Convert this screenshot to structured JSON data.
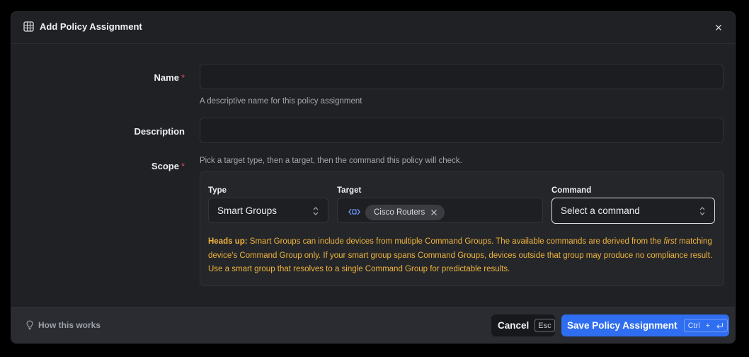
{
  "dialog": {
    "title": "Add Policy Assignment"
  },
  "form": {
    "name": {
      "label": "Name",
      "required_mark": "*",
      "value": "",
      "placeholder": "",
      "hint": "A descriptive name for this policy assignment"
    },
    "description": {
      "label": "Description",
      "value": "",
      "placeholder": ""
    },
    "scope": {
      "label": "Scope",
      "required_mark": "*",
      "hint": "Pick a target type, then a target, then the command this policy will check.",
      "type": {
        "label": "Type",
        "value": "Smart Groups"
      },
      "target": {
        "label": "Target",
        "selected": "Cisco Routers"
      },
      "command": {
        "label": "Command",
        "value": "Select a command"
      },
      "warning": {
        "title": "Heads up:",
        "text_before": "Smart Groups can include devices from multiple Command Groups. The available commands are derived from the",
        "emphasis": "first",
        "text_after": "matching device's Command Group only. If your smart group spans Command Groups, devices outside that group may produce no compliance result. Use a smart group that resolves to a single Command Group for predictable results."
      }
    }
  },
  "footer": {
    "help_link": "How this works",
    "cancel": {
      "label": "Cancel",
      "shortcut": "Esc"
    },
    "save": {
      "label": "Save Policy Assignment",
      "shortcut_mod": "Ctrl",
      "shortcut_plus": "+"
    }
  },
  "colors": {
    "accent": "#2f6ef0",
    "warning": "#f0b43c",
    "required": "#e0475e"
  }
}
